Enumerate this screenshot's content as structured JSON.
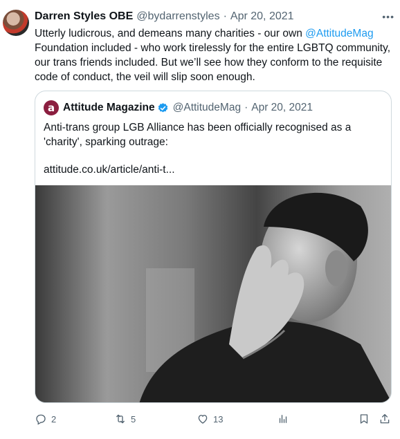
{
  "tweet": {
    "author": {
      "display_name": "Darren Styles OBE",
      "handle": "@bydarrenstyles",
      "separator": "·",
      "date": "Apr 20, 2021"
    },
    "more_label": "•••",
    "text_parts": {
      "before_mention": "Utterly ludicrous, and demeans many charities - our own ",
      "mention": "@AttitudeMag",
      "after_mention": " Foundation included - who work tirelessly for the entire LGBTQ community, our trans friends included. But we’ll see how they conform to the requisite code of conduct, the veil will slip soon enough."
    },
    "quote": {
      "avatar_letter": "a",
      "display_name": "Attitude Magazine",
      "handle": "@AttitudeMag",
      "separator": "·",
      "date": "Apr 20, 2021",
      "text": "Anti-trans group LGB Alliance has been officially recognised as a 'charity', sparking outrage:",
      "link": "attitude.co.uk/article/anti-t..."
    },
    "actions": {
      "replies": "2",
      "retweets": "5",
      "likes": "13"
    }
  },
  "colors": {
    "text": "#0f1419",
    "secondary": "#536471",
    "link": "#1d9bf0",
    "border": "#cfd9de",
    "attitude_brand": "#8b1e3f"
  },
  "icons": [
    "more-icon",
    "verified-badge-icon",
    "reply-icon",
    "retweet-icon",
    "like-icon",
    "views-icon",
    "bookmark-icon",
    "share-icon"
  ]
}
